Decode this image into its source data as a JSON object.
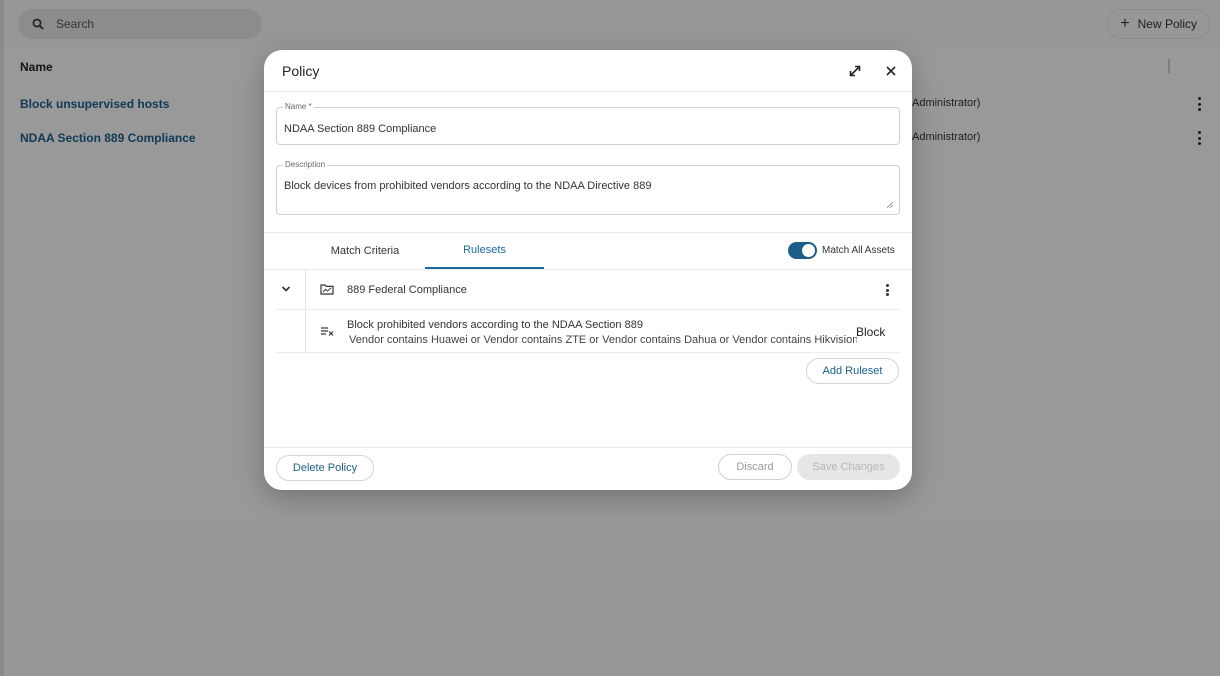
{
  "background": {
    "search": {
      "placeholder": "Search"
    },
    "new_policy_label": "New Policy",
    "table": {
      "column_header": "Name",
      "rows": [
        {
          "name": "Block unsupervised hosts",
          "owner": "Administrator)"
        },
        {
          "name": "NDAA Section 889 Compliance",
          "owner": "Administrator)"
        }
      ]
    }
  },
  "modal": {
    "title": "Policy",
    "name_field": {
      "label": "Name *",
      "value": "NDAA Section 889 Compliance"
    },
    "description_field": {
      "label": "Description",
      "value": "Block devices from prohibited vendors according to the NDAA Directive 889"
    },
    "tabs": [
      {
        "label": "Match Criteria",
        "active": false
      },
      {
        "label": "Rulesets",
        "active": true
      }
    ],
    "match_all_assets": {
      "label": "Match All Assets",
      "enabled": true
    },
    "ruleset": {
      "name": "889 Federal Compliance",
      "rule": {
        "name": "Block prohibited vendors according to the NDAA Section 889",
        "condition": "Vendor  contains Huawei or Vendor  contains ZTE or Vendor  contains Dahua or Vendor  contains Hikvision o...",
        "action": "Block"
      }
    },
    "buttons": {
      "add_ruleset": "Add Ruleset",
      "delete_policy": "Delete Policy",
      "discard": "Discard",
      "save_changes": "Save Changes"
    }
  },
  "colors": {
    "accent": "#1b5e8a",
    "link": "#1d6aa1",
    "disabled_text": "#b5b5b5"
  }
}
